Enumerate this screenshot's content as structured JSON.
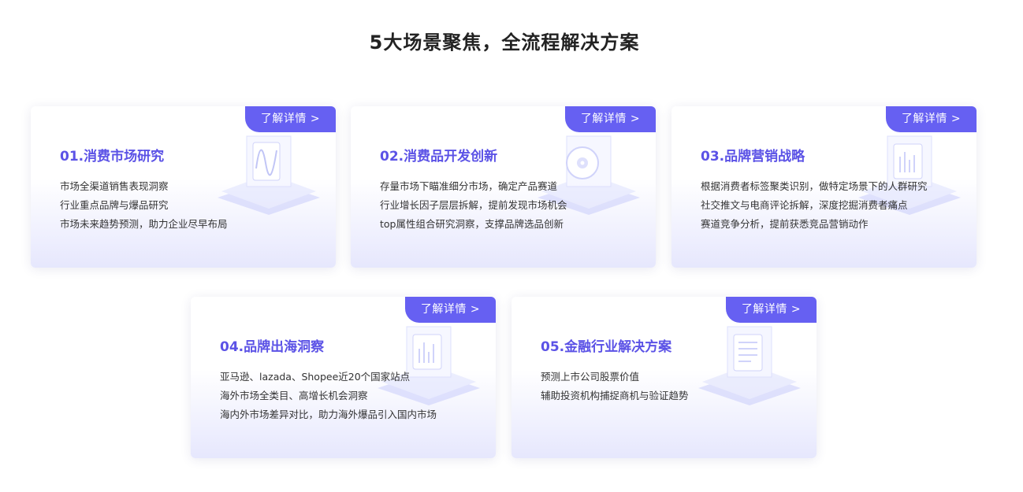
{
  "page": {
    "title": "5大场景聚焦，全流程解决方案"
  },
  "cards": [
    {
      "title": "01.消费市场研究",
      "button": "了解详情 >",
      "icon": "wave-chart-icon",
      "lines": [
        "市场全渠道销售表现洞察",
        "行业重点品牌与爆品研究",
        "市场未来趋势预测，助力企业尽早布局"
      ]
    },
    {
      "title": "02.消费品开发创新",
      "button": "了解详情 >",
      "icon": "disc-icon",
      "lines": [
        "存量市场下瞄准细分市场，确定产品赛道",
        "行业增长因子层层拆解，提前发现市场机会",
        "top属性组合研究洞察，支撑品牌选品创新"
      ]
    },
    {
      "title": "03.品牌营销战略",
      "button": "了解详情 >",
      "icon": "bar-chart-icon",
      "lines": [
        "根据消费者标签聚类识别，做特定场景下的人群研究",
        "社交推文与电商评论拆解，深度挖掘消费者痛点",
        "赛道竞争分析，提前获悉竞品营销动作"
      ]
    },
    {
      "title": "04.品牌出海洞察",
      "button": "了解详情 >",
      "icon": "bar-chart-icon",
      "lines": [
        "亚马逊、lazada、Shopee近20个国家站点",
        "海外市场全类目、高增长机会洞察",
        "海内外市场差异对比，助力海外爆品引入国内市场"
      ]
    },
    {
      "title": "05.金融行业解决方案",
      "button": "了解详情 >",
      "icon": "document-icon",
      "lines": [
        "预测上市公司股票价值",
        "辅助投资机构捕捉商机与验证趋势"
      ]
    }
  ],
  "colors": {
    "accent": "#6660f2",
    "title": "#5b52e6",
    "text": "#333333"
  }
}
